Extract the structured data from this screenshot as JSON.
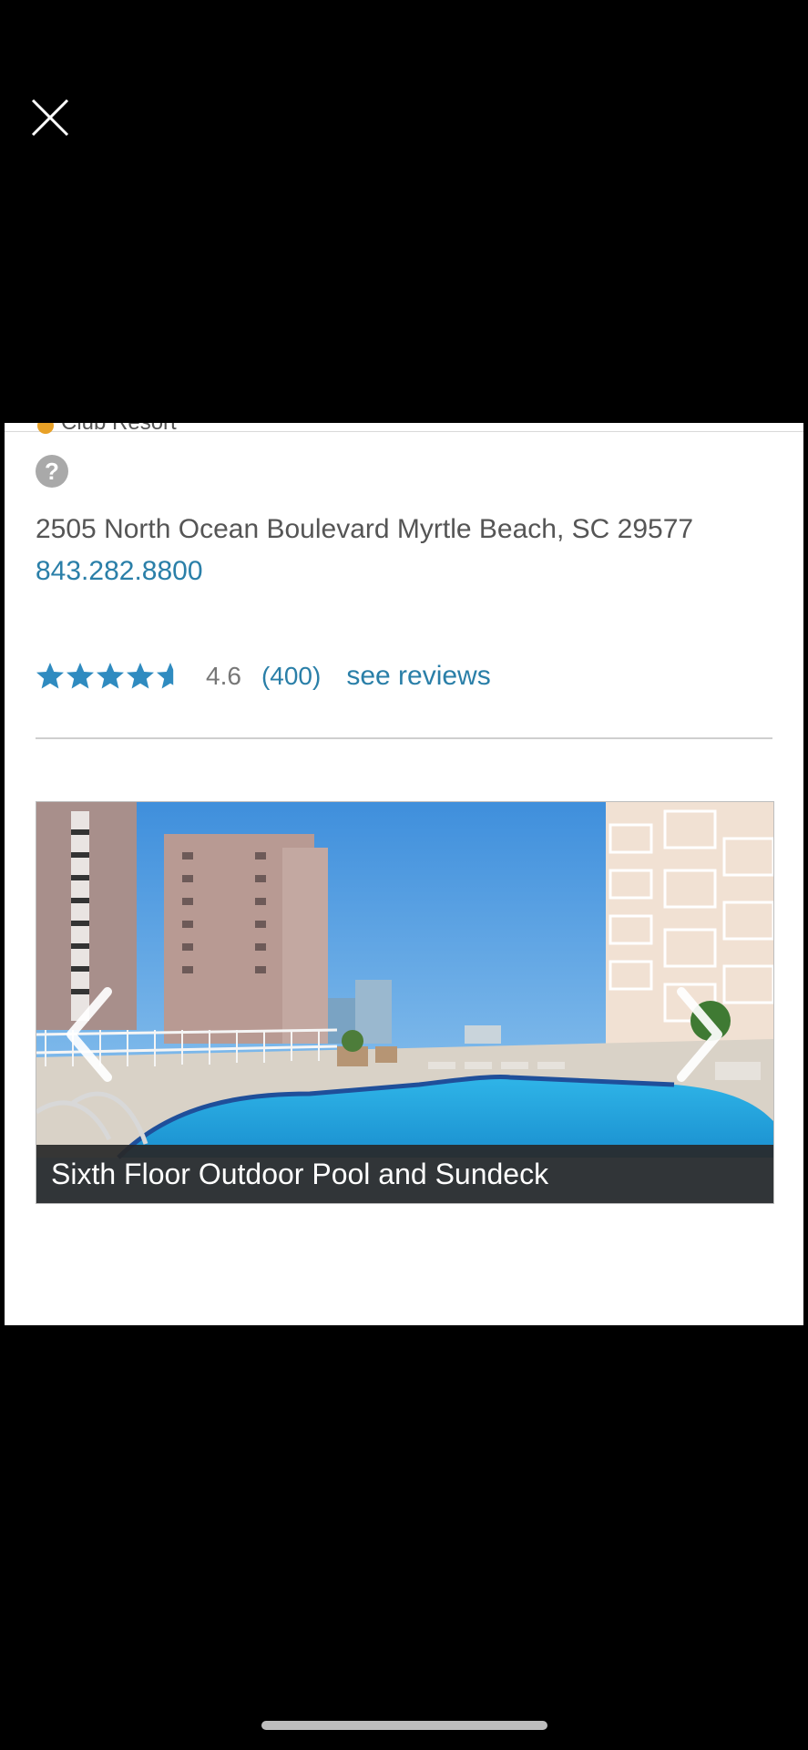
{
  "viewer": {
    "close_icon": "close-icon"
  },
  "listing": {
    "brand_text": "Club Resort",
    "help_icon": "?",
    "address": "2505 North Ocean Boulevard Myrtle Beach, SC 29577",
    "phone": "843.282.8800",
    "rating": {
      "stars_value": 4.6,
      "value_label": "4.6",
      "count_label": "(400)",
      "see_reviews_label": "see reviews"
    }
  },
  "gallery": {
    "caption": "Sixth Floor Outdoor Pool and Sundeck",
    "prev_icon": "chevron-left-icon",
    "next_icon": "chevron-right-icon"
  },
  "colors": {
    "link": "#2a7fa8",
    "star": "#2f8bc0",
    "text_muted": "#555555"
  }
}
